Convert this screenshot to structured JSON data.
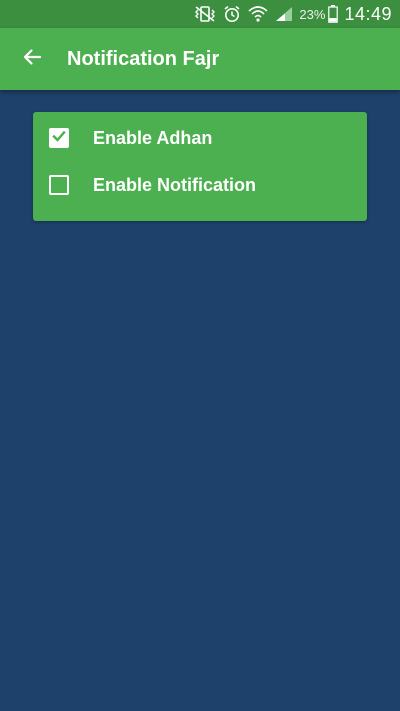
{
  "status_bar": {
    "battery_percent": "23%",
    "time": "14:49",
    "icons": [
      "vibrate-icon",
      "alarm-icon",
      "wifi-icon",
      "signal-icon",
      "battery-icon"
    ]
  },
  "app_bar": {
    "title": "Notification Fajr",
    "back_icon": "arrow-left-icon"
  },
  "options": [
    {
      "label": "Enable Adhan",
      "checked": true
    },
    {
      "label": "Enable Notification",
      "checked": false
    }
  ],
  "colors": {
    "status_bar": "#3b8f3f",
    "primary": "#4caf50",
    "background": "#1e416b",
    "text": "#ffffff"
  }
}
